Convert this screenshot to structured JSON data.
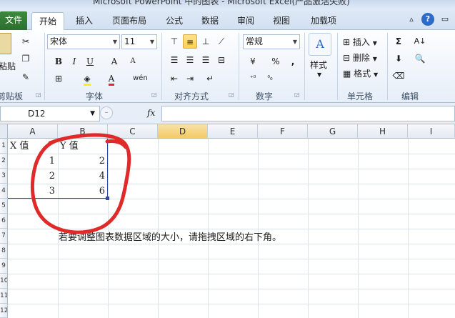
{
  "window": {
    "title": "Microsoft PowerPoint 中的图表 - Microsoft Excel(产品激活失败)"
  },
  "tabs": [
    {
      "label": "文件"
    },
    {
      "label": "开始"
    },
    {
      "label": "插入"
    },
    {
      "label": "页面布局"
    },
    {
      "label": "公式"
    },
    {
      "label": "数据"
    },
    {
      "label": "审阅"
    },
    {
      "label": "视图"
    },
    {
      "label": "加载项"
    }
  ],
  "ribbon": {
    "clipboard": {
      "label": "剪贴板",
      "paste": "粘贴"
    },
    "font": {
      "label": "字体",
      "name": "宋体",
      "size": "11",
      "bold": "B",
      "italic": "I",
      "underline": "U",
      "grow": "A",
      "shrink": "A",
      "wen": "wén"
    },
    "alignment": {
      "label": "对齐方式"
    },
    "number": {
      "label": "数字",
      "format": "常规",
      "percent": "%",
      "comma": ",",
      "inc_dec": "←.0\n.00",
      "dec_dec": ".00\n→.0"
    },
    "styles": {
      "label": "样式",
      "button": "样式"
    },
    "cells": {
      "label": "单元格",
      "insert": "插入",
      "delete": "删除",
      "format": "格式"
    },
    "editing": {
      "label": "编辑",
      "sum": "Σ"
    }
  },
  "formula_bar": {
    "name_box": "D12",
    "fx": "fx",
    "value": ""
  },
  "columns": [
    "A",
    "B",
    "C",
    "D",
    "E",
    "F",
    "G",
    "H",
    "I"
  ],
  "rows": [
    "1",
    "2",
    "3",
    "4",
    "5",
    "6",
    "7",
    "8",
    "9",
    "10",
    "11",
    "12"
  ],
  "sheet": {
    "header_x": "X 值",
    "header_y": "Y 值",
    "x_values": [
      "1",
      "2",
      "3"
    ],
    "y_values": [
      "2",
      "4",
      "6"
    ],
    "note": "若要调整图表数据区域的大小，请拖拽区域的右下角。"
  },
  "colors": {
    "file_tab": "#2b6f2e",
    "annotation": "#e02a2a",
    "table_border": "#2f48a3"
  }
}
